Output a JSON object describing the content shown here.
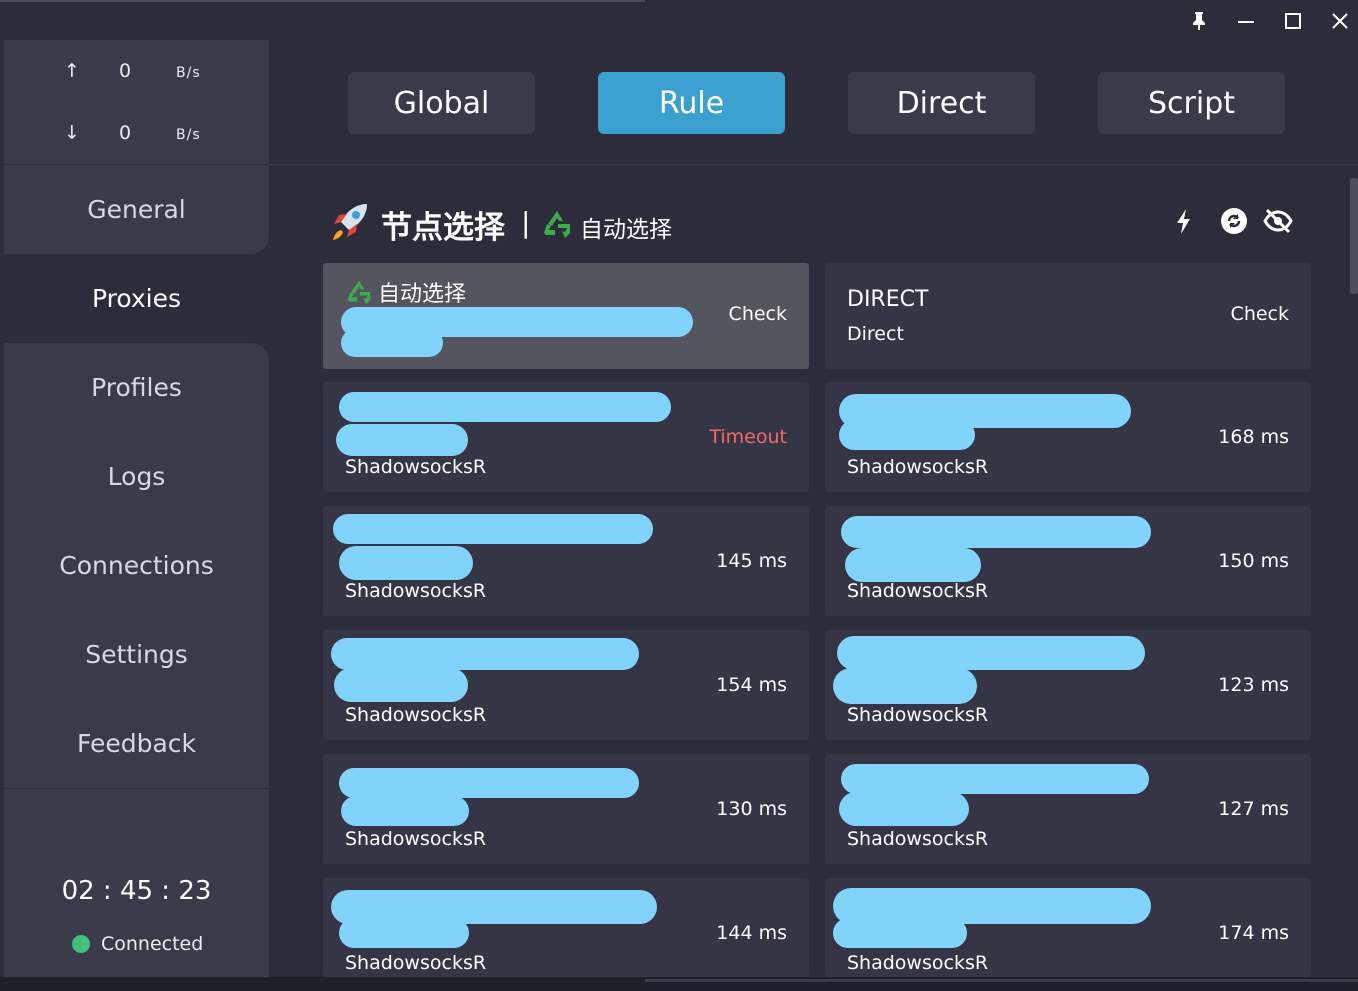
{
  "window": {
    "controls": [
      "pin-icon",
      "minimize-icon",
      "maximize-icon",
      "close-icon"
    ]
  },
  "traffic": {
    "up": {
      "arrow": "↑",
      "value": "0",
      "unit": "B/s"
    },
    "down": {
      "arrow": "↓",
      "value": "0",
      "unit": "B/s"
    }
  },
  "nav": {
    "items": [
      {
        "label": "General"
      },
      {
        "label": "Proxies"
      },
      {
        "label": "Profiles"
      },
      {
        "label": "Logs"
      },
      {
        "label": "Connections"
      },
      {
        "label": "Settings"
      },
      {
        "label": "Feedback"
      }
    ],
    "active": "Proxies"
  },
  "status": {
    "timer": "02 : 45 : 23",
    "connection": "Connected",
    "connection_color": "#43c07a"
  },
  "modes": {
    "items": [
      {
        "label": "Global"
      },
      {
        "label": "Rule"
      },
      {
        "label": "Direct"
      },
      {
        "label": "Script"
      }
    ],
    "active": "Rule",
    "accent": "#3b9fcf"
  },
  "group": {
    "title": "节点选择",
    "separator": "|",
    "selected": "自动选择",
    "icons": [
      "rocket-icon",
      "recycle-icon",
      "lightning-icon",
      "refresh-icon",
      "eye-off-icon"
    ]
  },
  "proxies": [
    {
      "name": "自动选择",
      "type": "",
      "delay": "Check",
      "selected": true
    },
    {
      "name": "DIRECT",
      "type": "Direct",
      "delay": "Check"
    },
    {
      "name": "",
      "type": "ShadowsocksR",
      "delay": "Timeout",
      "timeout": true
    },
    {
      "name": "",
      "type": "ShadowsocksR",
      "delay": "168 ms"
    },
    {
      "name": "",
      "type": "ShadowsocksR",
      "delay": "145 ms"
    },
    {
      "name": "",
      "type": "ShadowsocksR",
      "delay": "150 ms"
    },
    {
      "name": "",
      "type": "ShadowsocksR",
      "delay": "154 ms"
    },
    {
      "name": "",
      "type": "ShadowsocksR",
      "delay": "123 ms"
    },
    {
      "name": "",
      "type": "ShadowsocksR",
      "delay": "130 ms"
    },
    {
      "name": "",
      "type": "ShadowsocksR",
      "delay": "127 ms"
    },
    {
      "name": "",
      "type": "ShadowsocksR",
      "delay": "144 ms"
    },
    {
      "name": "",
      "type": "ShadowsocksR",
      "delay": "174 ms"
    }
  ],
  "colors": {
    "background": "#2c2c3b",
    "panel": "#3a3a4a",
    "card": "#353546",
    "timeout": "#f06a6a",
    "redaction": "#82d3fb"
  }
}
